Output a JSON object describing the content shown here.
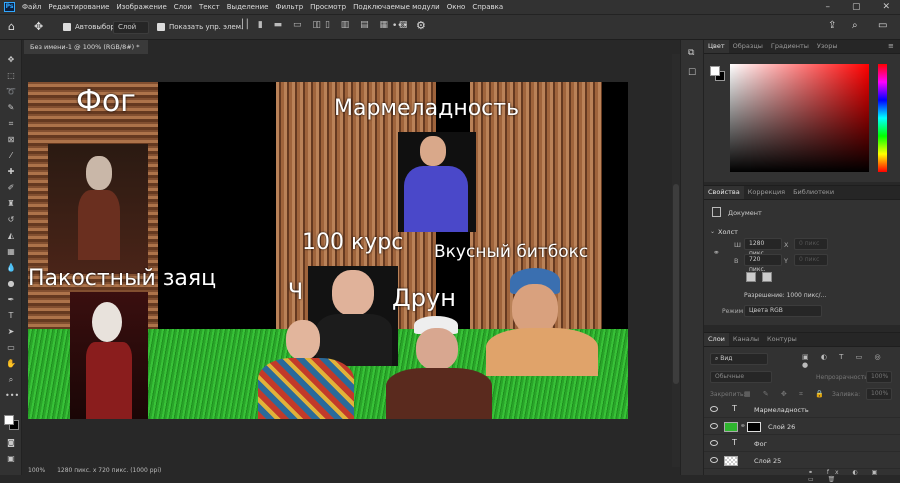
{
  "app": {
    "logo": "Ps"
  },
  "menu": [
    "Файл",
    "Редактирование",
    "Изображение",
    "Слои",
    "Текст",
    "Выделение",
    "Фильтр",
    "Просмотр",
    "Подключаемые модули",
    "Окно",
    "Справка"
  ],
  "options": {
    "autoselect_label": "Автовыбор:",
    "autoselect_value": "Слой",
    "show_controls_label": "Показать упр. элем."
  },
  "document": {
    "tab_title": "Без имени-1 @ 100% (RGB/8#) *",
    "zoom": "100%",
    "status": "1280 пикс. x 720 пикс. (1000 ppi)"
  },
  "canvas_texts": {
    "t1": "Фог",
    "t2": "Мармеладность",
    "t3": "100 курс",
    "t4": "Вкусный битбокс",
    "t5": "Пакостный заяц",
    "t6": "Ч",
    "t7": "Друн"
  },
  "color_panel": {
    "tabs": [
      "Цвет",
      "Образцы",
      "Градиенты",
      "Узоры"
    ],
    "active": "Цвет",
    "fg": "#ffffff",
    "bg": "#000000"
  },
  "props_panel": {
    "tabs": [
      "Свойства",
      "Коррекция",
      "Библиотеки"
    ],
    "section_doc": "Документ",
    "section_canvas": "Холст",
    "w_label": "Ш",
    "w_value": "1280 пикс",
    "h_label": "В",
    "h_value": "720 пикс.",
    "x_label": "X",
    "y_label": "Y",
    "x_placeholder": "0 пикс",
    "y_placeholder": "0 пикс",
    "resolution": "Разрешение: 1000 пикс/...",
    "mode_label": "Режим",
    "mode_value": "Цвета RGB"
  },
  "layers_panel": {
    "tabs": [
      "Слои",
      "Каналы",
      "Контуры"
    ],
    "filter_value": "Вид",
    "blend_mode": "Обычные",
    "opacity_label": "Непрозрачность:",
    "opacity_value": "100%",
    "lock_label": "Закрепить:",
    "fill_label": "Заливка:",
    "fill_value": "100%",
    "layers": [
      {
        "name": "Мармеладность",
        "type": "text"
      },
      {
        "name": "Слой 26",
        "type": "image"
      },
      {
        "name": "Фог",
        "type": "text"
      },
      {
        "name": "Слой 25",
        "type": "image"
      }
    ]
  },
  "colors": {
    "accent": "#31a8ff",
    "grass": "#2fb52f"
  }
}
